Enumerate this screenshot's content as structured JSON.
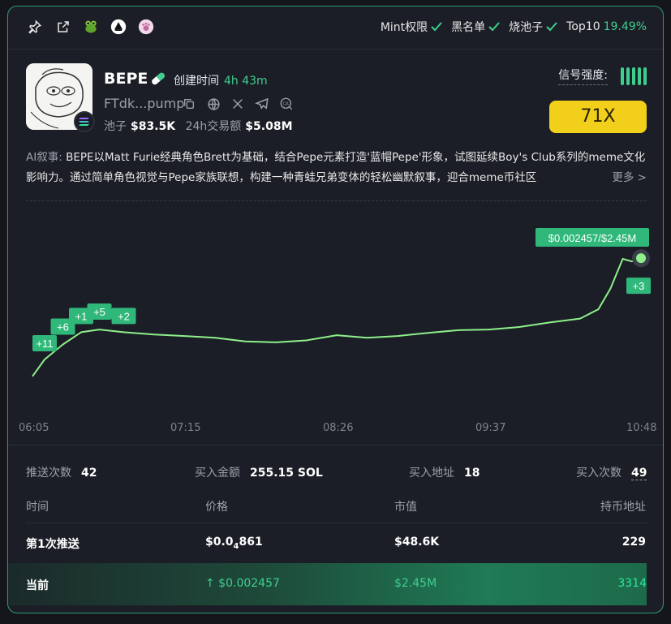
{
  "topbar": {
    "icons": [
      "pin-icon",
      "external-link-icon",
      "frog-icon",
      "avalanche-icon",
      "paw-icon"
    ],
    "flags": [
      {
        "label": "Mint权限",
        "checked": true
      },
      {
        "label": "黑名单",
        "checked": true
      },
      {
        "label": "烧池子",
        "checked": true
      },
      {
        "label": "Top10",
        "value": "19.49%"
      }
    ]
  },
  "token": {
    "name": "BEPE",
    "created_label": "创建时间",
    "created_value": "4h 43m",
    "address": "FTdk...pump",
    "pool_label": "池子",
    "pool_value": "$83.5K",
    "volume_label": "24h交易额",
    "volume_value": "$5.08M",
    "chain_icon": "solana-icon",
    "social_icons": [
      "copy-icon",
      "globe-icon",
      "x-icon",
      "telegram-icon",
      "ca-icon"
    ]
  },
  "signal": {
    "label": "信号强度:",
    "bars": 5,
    "multiplier": "71X"
  },
  "ai": {
    "prefix": "AI叙事:",
    "text": "BEPE以Matt Furie经典角色Brett为基础，结合Pepe元素打造'蓝帽Pepe'形象，试图延续Boy's Club系列的meme文化影响力。通过简单角色视觉与Pepe家族联想，构建一种青蛙兄弟变体的轻松幽默叙事，迎合meme币社区",
    "more": "更多 >"
  },
  "chart_data": {
    "type": "line",
    "x_ticks": [
      "06:05",
      "07:15",
      "08:26",
      "09:37",
      "10:48"
    ],
    "series": [
      {
        "values": [
          [
            0,
            4.86e-05
          ],
          [
            0.02,
            8.5e-05
          ],
          [
            0.05,
            0.00014
          ],
          [
            0.08,
            0.00021
          ],
          [
            0.11,
            0.00023
          ],
          [
            0.15,
            0.00021
          ],
          [
            0.2,
            0.000195
          ],
          [
            0.25,
            0.000185
          ],
          [
            0.3,
            0.000175
          ],
          [
            0.35,
            0.000155
          ],
          [
            0.4,
            0.00015
          ],
          [
            0.45,
            0.00016
          ],
          [
            0.5,
            0.00019
          ],
          [
            0.55,
            0.000175
          ],
          [
            0.6,
            0.000185
          ],
          [
            0.65,
            0.000205
          ],
          [
            0.7,
            0.000225
          ],
          [
            0.75,
            0.00023
          ],
          [
            0.8,
            0.00025
          ],
          [
            0.85,
            0.00029
          ],
          [
            0.9,
            0.00033
          ],
          [
            0.93,
            0.00045
          ],
          [
            0.95,
            0.0009
          ],
          [
            0.97,
            0.0024
          ],
          [
            0.985,
            0.0022
          ],
          [
            1.0,
            0.002457
          ]
        ],
        "color": "#8ef08a"
      }
    ],
    "markers": [
      {
        "label": "+11",
        "t": 0.02
      },
      {
        "label": "+6",
        "t": 0.05
      },
      {
        "label": "+1",
        "t": 0.08
      },
      {
        "label": "+5",
        "t": 0.11
      },
      {
        "label": "+2",
        "t": 0.15
      },
      {
        "label": "+3",
        "t": 1.0
      }
    ],
    "current_label": "$0.002457/$2.45M"
  },
  "summary": {
    "push_count_label": "推送次数",
    "push_count": "42",
    "buy_amount_label": "买入金额",
    "buy_amount": "255.15 SOL",
    "buy_addr_label": "买入地址",
    "buy_addr": "18",
    "buy_times_label": "买入次数",
    "buy_times": "49"
  },
  "table": {
    "headers": [
      "时间",
      "价格",
      "市值",
      "持币地址"
    ],
    "first": {
      "label": "第1次推送",
      "price_prefix": "$0.0",
      "price_sub": "4",
      "price_rest": "861",
      "mcap": "$48.6K",
      "holders": "229"
    },
    "current": {
      "label": "当前",
      "price": "↑ $0.002457",
      "mcap": "$2.45M",
      "holders": "3314"
    }
  }
}
